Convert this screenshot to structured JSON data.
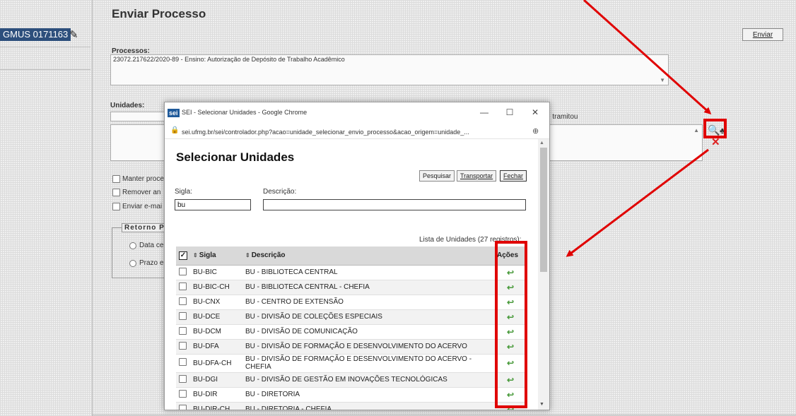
{
  "app": {
    "user_badge": "GMUS 0171163",
    "page_title": "Enviar Processo",
    "enviar_button": "Enviar",
    "processos_label": "Processos:",
    "processos_value": "23072.217622/2020-89 - Ensino: Autorização de Depósito de Trabalho Acadêmico",
    "unidades_label": "Unidades:",
    "tramitou_text": "e tramitou",
    "options": [
      {
        "label": "Manter proce"
      },
      {
        "label": "Remover an"
      },
      {
        "label": "Enviar e-mai"
      }
    ],
    "retorno_legend": "Retorno P",
    "retorno_options": [
      {
        "label": "Data ce"
      },
      {
        "label": "Prazo e"
      }
    ]
  },
  "popup": {
    "window_title": "SEI - Selecionar Unidades - Google Chrome",
    "logo_text": "sei",
    "url": "sei.ufmg.br/sei/controlador.php?acao=unidade_selecionar_envio_processo&acao_origem=unidade_...",
    "heading": "Selecionar Unidades",
    "buttons": {
      "pesquisar": "Pesquisar",
      "transportar": "Transportar",
      "fechar": "Fechar"
    },
    "sigla_label": "Sigla:",
    "sigla_value": "bu",
    "descricao_label": "Descrição:",
    "descricao_value": "",
    "caption": "Lista de Unidades (27 registros):",
    "columns": {
      "sigla": "Sigla",
      "descricao": "Descrição",
      "acoes": "Ações"
    },
    "rows": [
      {
        "sigla": "BU-BIC",
        "descricao": "BU - BIBLIOTECA CENTRAL"
      },
      {
        "sigla": "BU-BIC-CH",
        "descricao": "BU - BIBLIOTECA CENTRAL - CHEFIA"
      },
      {
        "sigla": "BU-CNX",
        "descricao": "BU - CENTRO DE EXTENSÃO"
      },
      {
        "sigla": "BU-DCE",
        "descricao": "BU - DIVISÃO DE COLEÇÕES ESPECIAIS"
      },
      {
        "sigla": "BU-DCM",
        "descricao": "BU - DIVISÃO DE COMUNICAÇÃO"
      },
      {
        "sigla": "BU-DFA",
        "descricao": "BU - DIVISÃO DE FORMAÇÃO E DESENVOLVIMENTO DO ACERVO"
      },
      {
        "sigla": "BU-DFA-CH",
        "descricao": "BU - DIVISÃO DE FORMAÇÃO E DESENVOLVIMENTO DO ACERVO - CHEFIA"
      },
      {
        "sigla": "BU-DGI",
        "descricao": "BU - DIVISÃO DE GESTÃO EM INOVAÇÕES TECNOLÓGICAS"
      },
      {
        "sigla": "BU-DIR",
        "descricao": "BU - DIRETORIA"
      },
      {
        "sigla": "BU-DIR-CH",
        "descricao": "BU - DIRETORIA - CHEFIA"
      }
    ]
  },
  "colors": {
    "annotation": "#e00000",
    "action_icon": "#4a9b3c",
    "badge_bg": "#2d4f7c"
  }
}
